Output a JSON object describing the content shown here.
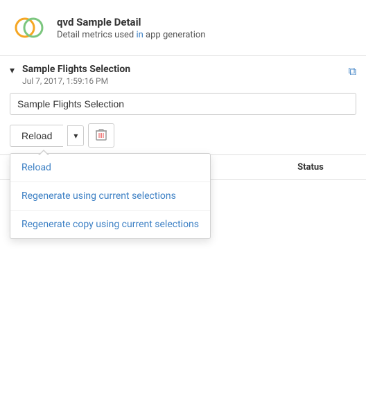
{
  "header": {
    "title": "qvd Sample Detail",
    "subtitle_prefix": "Detail metrics used ",
    "subtitle_link": "in",
    "subtitle_suffix": " app generation",
    "logo_alt": "qvd logo"
  },
  "section": {
    "title": "Sample Flights Selection",
    "timestamp": "Jul 7, 2017, 1:59:16 PM"
  },
  "input": {
    "value": "Sample Flights Selection",
    "placeholder": "Sample Flights Selection"
  },
  "buttons": {
    "reload_label": "Reload",
    "dropdown_aria": "dropdown",
    "delete_aria": "Delete"
  },
  "dropdown": {
    "items": [
      {
        "id": "reload",
        "label": "Reload"
      },
      {
        "id": "regen",
        "label": "Regenerate using current selections"
      },
      {
        "id": "regen-copy",
        "label": "Regenerate copy using current selections"
      }
    ]
  },
  "table": {
    "columns": [
      {
        "id": "status",
        "label": "Status"
      }
    ]
  },
  "icons": {
    "chevron_down": "▾",
    "external_link": "⧉",
    "dropdown_arrow": "▾",
    "trash": "🗑"
  }
}
